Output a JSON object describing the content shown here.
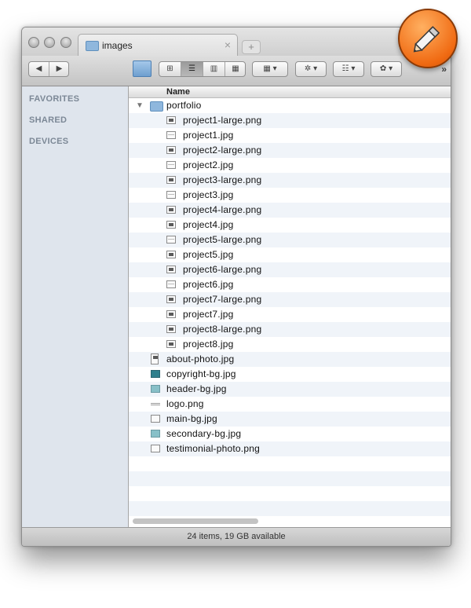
{
  "window": {
    "tab_title": "images",
    "tab_close": "×",
    "tab_add": "+"
  },
  "toolbar": {
    "back": "◀",
    "forward": "▶",
    "view_icon": "⊞",
    "view_list": "☰",
    "view_columns": "▥",
    "view_coverflow": "▦",
    "arrange_label": "▦ ▾",
    "action_label": "✲ ▾",
    "share_label": "☷ ▾",
    "dropbox_label": "✿ ▾",
    "overflow": "»"
  },
  "sidebar": {
    "sections": [
      "FAVORITES",
      "SHARED",
      "DEVICES"
    ]
  },
  "list": {
    "column_name": "Name",
    "folder": "portfolio",
    "folder_items": [
      {
        "name": "project1-large.png",
        "icon": "image-icon"
      },
      {
        "name": "project1.jpg",
        "icon": "image-light-icon"
      },
      {
        "name": "project2-large.png",
        "icon": "image-icon"
      },
      {
        "name": "project2.jpg",
        "icon": "image-light-icon"
      },
      {
        "name": "project3-large.png",
        "icon": "image-icon"
      },
      {
        "name": "project3.jpg",
        "icon": "image-light-icon"
      },
      {
        "name": "project4-large.png",
        "icon": "image-icon"
      },
      {
        "name": "project4.jpg",
        "icon": "image-icon"
      },
      {
        "name": "project5-large.png",
        "icon": "image-light-icon"
      },
      {
        "name": "project5.jpg",
        "icon": "image-icon"
      },
      {
        "name": "project6-large.png",
        "icon": "image-icon"
      },
      {
        "name": "project6.jpg",
        "icon": "image-light-icon"
      },
      {
        "name": "project7-large.png",
        "icon": "image-icon"
      },
      {
        "name": "project7.jpg",
        "icon": "image-icon"
      },
      {
        "name": "project8-large.png",
        "icon": "image-icon"
      },
      {
        "name": "project8.jpg",
        "icon": "image-icon"
      }
    ],
    "root_items": [
      {
        "name": "about-photo.jpg",
        "icon": "document-image-icon"
      },
      {
        "name": "copyright-bg.jpg",
        "icon": "teal-image-icon"
      },
      {
        "name": "header-bg.jpg",
        "icon": "light-teal-image-icon"
      },
      {
        "name": "logo.png",
        "icon": "thin-image-icon"
      },
      {
        "name": "main-bg.jpg",
        "icon": "blank-image-icon"
      },
      {
        "name": "secondary-bg.jpg",
        "icon": "light-teal-image-icon"
      },
      {
        "name": "testimonial-photo.png",
        "icon": "blank-image-icon"
      }
    ]
  },
  "status": {
    "text": "24 items, 19 GB available"
  },
  "badge": {
    "icon": "pencil-icon",
    "color": "#f06a12"
  }
}
